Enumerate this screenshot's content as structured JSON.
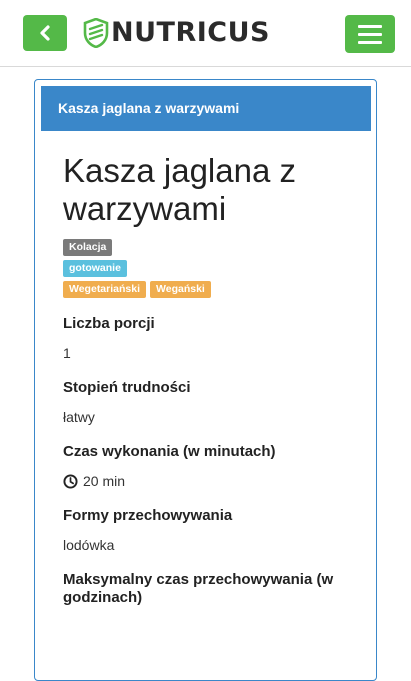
{
  "header": {
    "brand": "NUTRICUS",
    "accent_color": "#54b948",
    "back_icon": "chevron-left-icon",
    "menu_icon": "hamburger-icon"
  },
  "panel": {
    "heading": "Kasza jaglana z warzywami",
    "heading_color": "#3a87c9"
  },
  "recipe": {
    "title": "Kasza jaglana z warzywami",
    "labels": {
      "meal": "Kolacja",
      "method": "gotowanie",
      "diet1": "Wegetariański",
      "diet2": "Wegański"
    },
    "fields": {
      "portions_label": "Liczba porcji",
      "portions_value": "1",
      "difficulty_label": "Stopień trudności",
      "difficulty_value": "łatwy",
      "time_label": "Czas wykonania (w minutach)",
      "time_value": "20 min",
      "storage_label": "Formy przechowywania",
      "storage_value": "lodówka",
      "max_storage_label": "Maksymalny czas przechowywania (w godzinach)"
    }
  }
}
